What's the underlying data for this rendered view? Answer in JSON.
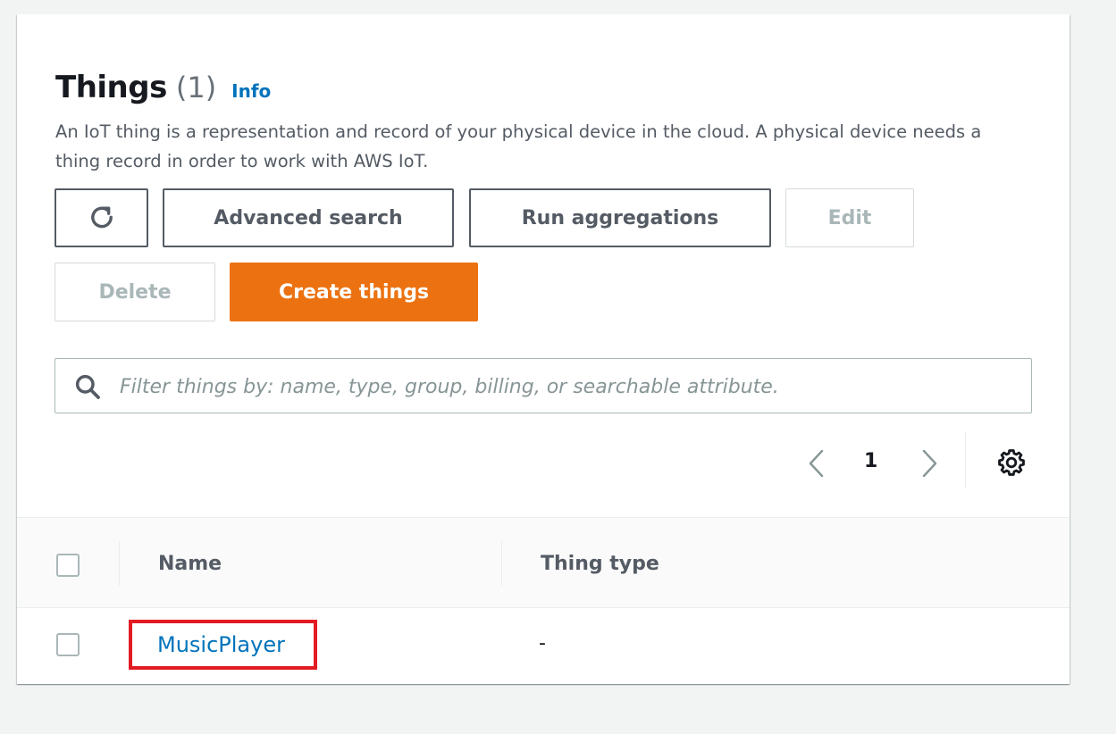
{
  "header": {
    "title": "Things",
    "count": "(1)",
    "info_label": "Info",
    "description": "An IoT thing is a representation and record of your physical device in the cloud. A physical device needs a thing record in order to work with AWS IoT."
  },
  "toolbar": {
    "refresh_icon": "refresh-icon",
    "advanced_search_label": "Advanced search",
    "run_aggregations_label": "Run aggregations",
    "edit_label": "Edit",
    "delete_label": "Delete",
    "create_label": "Create things"
  },
  "search": {
    "icon": "search-icon",
    "value": "",
    "placeholder": "Filter things by: name, type, group, billing, or searchable attribute."
  },
  "pagination": {
    "current_page": "1",
    "prev_icon": "chevron-left-icon",
    "next_icon": "chevron-right-icon",
    "settings_icon": "gear-icon"
  },
  "table": {
    "columns": [
      "Name",
      "Thing type"
    ],
    "rows": [
      {
        "name": "MusicPlayer",
        "thing_type": "-",
        "selected": false
      }
    ],
    "header_selected": false
  },
  "colors": {
    "primary_button": "#ec7211",
    "link": "#0073bb",
    "highlight_box": "#e31b23",
    "background": "#f2f3f3"
  }
}
